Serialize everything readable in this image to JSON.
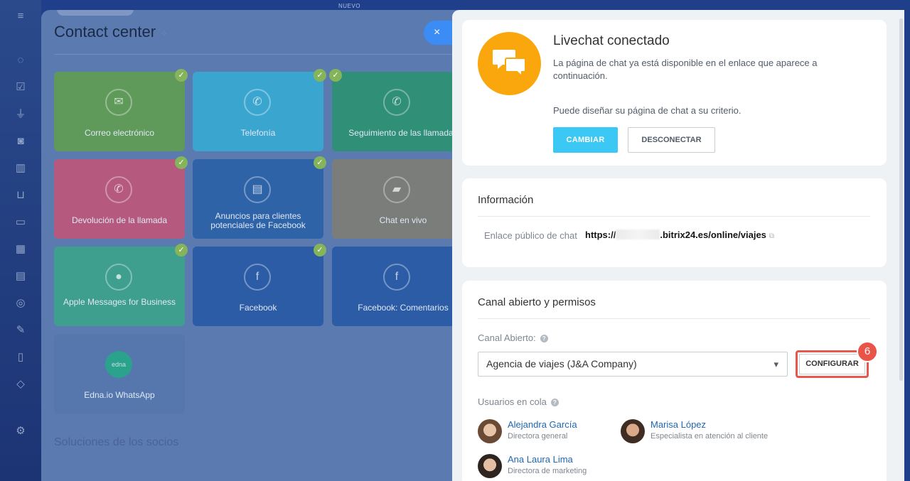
{
  "background": {
    "page_title": "Contact center",
    "new_label": "NUEVO",
    "partners_heading": "Soluciones de los socios",
    "tiles": [
      {
        "label": "Correo electrónico",
        "icon": "mail-icon",
        "color": "#5f9a5a",
        "connected": true
      },
      {
        "label": "Telefonía",
        "icon": "phone-icon",
        "color": "#3aa6cf",
        "connected": true
      },
      {
        "label": "Seguimiento de las llamadas",
        "icon": "call-tracking-icon",
        "color": "#2f8f77",
        "connected": true
      },
      {
        "label": "Devolución de la llamada",
        "icon": "callback-icon",
        "color": "#b55a7e",
        "connected": true
      },
      {
        "label": "Anuncios para clientes potenciales de Facebook",
        "icon": "facebook-leads-icon",
        "color": "#2e63a8",
        "connected": true
      },
      {
        "label": "Chat en vivo",
        "icon": "livechat-icon",
        "color": "#7b7d7a",
        "connected": false
      },
      {
        "label": "Apple Messages for Business",
        "icon": "apple-messages-icon",
        "color": "#3f9f8e",
        "connected": true
      },
      {
        "label": "Facebook",
        "icon": "facebook-icon",
        "color": "#2c5ca6",
        "connected": true
      },
      {
        "label": "Facebook: Comentarios",
        "icon": "facebook-comments-icon",
        "color": "#2c5ca6",
        "connected": false
      },
      {
        "label": "Edna.io WhatsApp",
        "icon": "edna-icon",
        "color": "#5577ad",
        "connected": false
      }
    ]
  },
  "close_icon": "×",
  "livechat": {
    "title": "Livechat conectado",
    "description": "La página de chat ya está disponible en el enlace que aparece a continuación.",
    "description2": "Puede diseñar su página de chat a su criterio.",
    "change_button": "CAMBIAR",
    "disconnect_button": "DESCONECTAR",
    "badge_color": "#f9a70d"
  },
  "info": {
    "title": "Información",
    "public_link_label": "Enlace público de chat",
    "public_link_prefix": "https://",
    "public_link_suffix": ".bitrix24.es/online/viajes"
  },
  "permissions": {
    "title": "Canal abierto y permisos",
    "channel_label": "Canal Abierto:",
    "channel_value": "Agencia de viajes (J&A Company)",
    "configure_button": "CONFIGURAR",
    "step_number": "6",
    "queue_label": "Usuarios en cola",
    "users": [
      {
        "name": "Alejandra García",
        "role": "Directora general"
      },
      {
        "name": "Marisa López",
        "role": "Especialista en atención al cliente"
      },
      {
        "name": "Ana Laura Lima",
        "role": "Directora de marketing"
      }
    ]
  }
}
